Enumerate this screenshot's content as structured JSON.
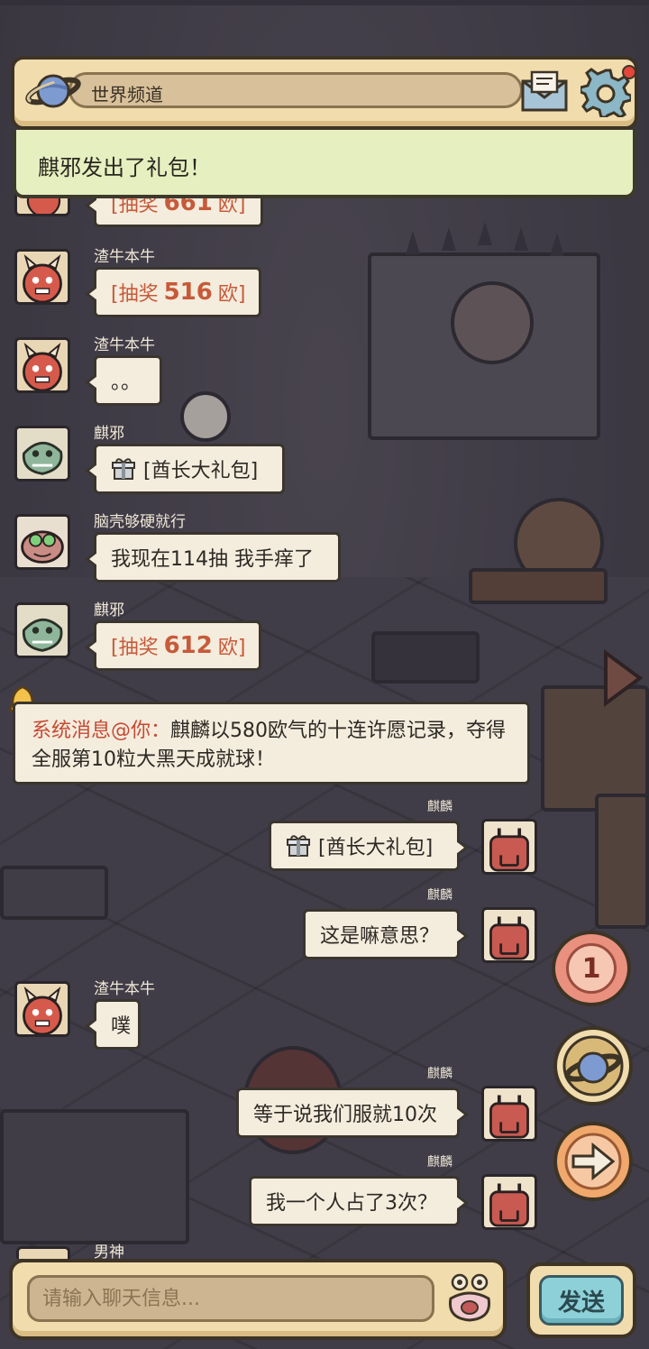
{
  "topbar": {
    "channel_label": "世界频道",
    "icons": [
      "planet-icon",
      "mail-icon",
      "gear-icon"
    ],
    "has_notification": true
  },
  "notice": {
    "text": "麒邪发出了礼包！"
  },
  "messages": [
    {
      "id": "m1",
      "side": "left",
      "user": "渣牛本牛",
      "type": "lottery",
      "prefix": "[抽奖",
      "value": "516",
      "suffix": "欧]"
    },
    {
      "id": "m2",
      "side": "left",
      "user": "渣牛本牛",
      "type": "text",
      "text": "。。"
    },
    {
      "id": "m3",
      "side": "left",
      "user": "麒邪",
      "type": "gift",
      "text": "[酋长大礼包]"
    },
    {
      "id": "m4",
      "side": "left",
      "user": "脑壳够硬就行",
      "type": "text",
      "text": "我现在114抽  我手痒了"
    },
    {
      "id": "m5",
      "side": "left",
      "user": "麒邪",
      "type": "lottery",
      "prefix": "[抽奖",
      "value": "612",
      "suffix": "欧]"
    },
    {
      "id": "m6",
      "side": "right",
      "user": "麒麟",
      "type": "gift",
      "text": "[酋长大礼包]"
    },
    {
      "id": "m7",
      "side": "right",
      "user": "麒麟",
      "type": "text",
      "text": "这是嘛意思？"
    },
    {
      "id": "m8",
      "side": "left",
      "user": "渣牛本牛",
      "type": "text",
      "text": "噗"
    },
    {
      "id": "m9",
      "side": "right",
      "user": "麒麟",
      "type": "text",
      "text": "等于说我们服就10次"
    },
    {
      "id": "m10",
      "side": "right",
      "user": "麒麟",
      "type": "text",
      "text": "我一个人占了3次？"
    }
  ],
  "partial": {
    "top_lottery_value": "661",
    "top_lottery_prefix": "[抽奖",
    "top_lottery_suffix": "欧]",
    "bottom_user": "男神"
  },
  "system_message": {
    "prefix": "系统消息@你：",
    "text": "麒麟以580欧气的十连许愿记录，夺得全服第10粒大黑天成就球！"
  },
  "side_buttons": {
    "unread_count": "1"
  },
  "input": {
    "placeholder": "请输入聊天信息...",
    "value": ""
  },
  "send_label": "发送",
  "colors": {
    "panel": "#f1dcae",
    "bubble": "#f4ecdd",
    "lottery": "#c65a3a",
    "notice_bg": "#e6efbf",
    "send_btn": "#8ed0d8"
  }
}
